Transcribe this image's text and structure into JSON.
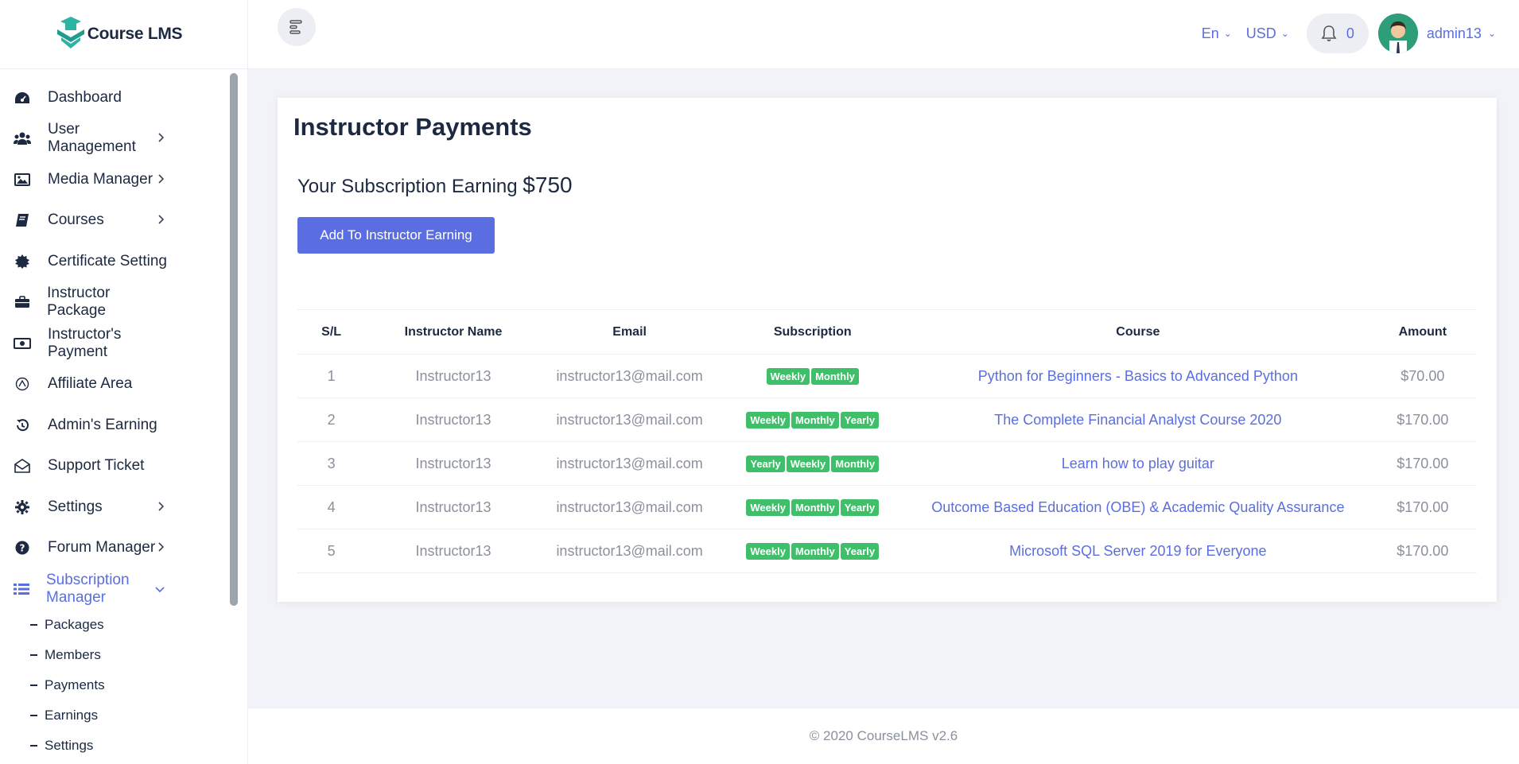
{
  "brand": {
    "name": "Course LMS"
  },
  "sidebar": {
    "items": [
      {
        "label": "Dashboard",
        "icon": "dashboard-icon",
        "chevron": false
      },
      {
        "label": "User Management",
        "icon": "users-icon",
        "chevron": true
      },
      {
        "label": "Media Manager",
        "icon": "image-icon",
        "chevron": true
      },
      {
        "label": "Courses",
        "icon": "book-icon",
        "chevron": true
      },
      {
        "label": "Certificate Setting",
        "icon": "certificate-icon",
        "chevron": false
      },
      {
        "label": "Instructor Package",
        "icon": "briefcase-icon",
        "chevron": false
      },
      {
        "label": "Instructor's Payment",
        "icon": "money-icon",
        "chevron": false
      },
      {
        "label": "Affiliate Area",
        "icon": "affiliate-icon",
        "chevron": false
      },
      {
        "label": "Admin's Earning",
        "icon": "history-icon",
        "chevron": false
      },
      {
        "label": "Support Ticket",
        "icon": "envelope-open-icon",
        "chevron": false
      },
      {
        "label": "Settings",
        "icon": "gear-icon",
        "chevron": true
      },
      {
        "label": "Forum Manager",
        "icon": "question-icon",
        "chevron": true
      },
      {
        "label": "Subscription Manager",
        "icon": "list-icon",
        "chevron": true,
        "active": true
      }
    ],
    "subitems": [
      "Packages",
      "Members",
      "Payments",
      "Earnings",
      "Settings"
    ]
  },
  "header": {
    "language": "En",
    "currency": "USD",
    "notification_count": "0",
    "username": "admin13"
  },
  "main": {
    "title": "Instructor Payments",
    "earning_label": "Your Subscription Earning",
    "earning_value": "$750",
    "add_button": "Add To Instructor Earning",
    "table": {
      "headers": [
        "S/L",
        "Instructor Name",
        "Email",
        "Subscription",
        "Course",
        "Amount"
      ],
      "rows": [
        {
          "sl": "1",
          "name": "Instructor13",
          "email": "instructor13@mail.com",
          "subs": [
            "Weekly",
            "Monthly"
          ],
          "course": "Python for Beginners - Basics to Advanced Python",
          "amount": "$70.00"
        },
        {
          "sl": "2",
          "name": "Instructor13",
          "email": "instructor13@mail.com",
          "subs": [
            "Weekly",
            "Monthly",
            "Yearly"
          ],
          "course": "The Complete Financial Analyst Course 2020",
          "amount": "$170.00"
        },
        {
          "sl": "3",
          "name": "Instructor13",
          "email": "instructor13@mail.com",
          "subs": [
            "Yearly",
            "Weekly",
            "Monthly"
          ],
          "course": "Learn how to play guitar",
          "amount": "$170.00"
        },
        {
          "sl": "4",
          "name": "Instructor13",
          "email": "instructor13@mail.com",
          "subs": [
            "Weekly",
            "Monthly",
            "Yearly"
          ],
          "course": "Outcome Based Education (OBE) & Academic Quality Assurance",
          "amount": "$170.00"
        },
        {
          "sl": "5",
          "name": "Instructor13",
          "email": "instructor13@mail.com",
          "subs": [
            "Weekly",
            "Monthly",
            "Yearly"
          ],
          "course": "Microsoft SQL Server 2019 for Everyone",
          "amount": "$170.00"
        }
      ]
    }
  },
  "footer": {
    "text": "© 2020 CourseLMS v2.6"
  },
  "colors": {
    "accent": "#5b6ee1",
    "badge": "#3fbf6a",
    "text": "#1c2940",
    "muted": "#8a909c"
  }
}
